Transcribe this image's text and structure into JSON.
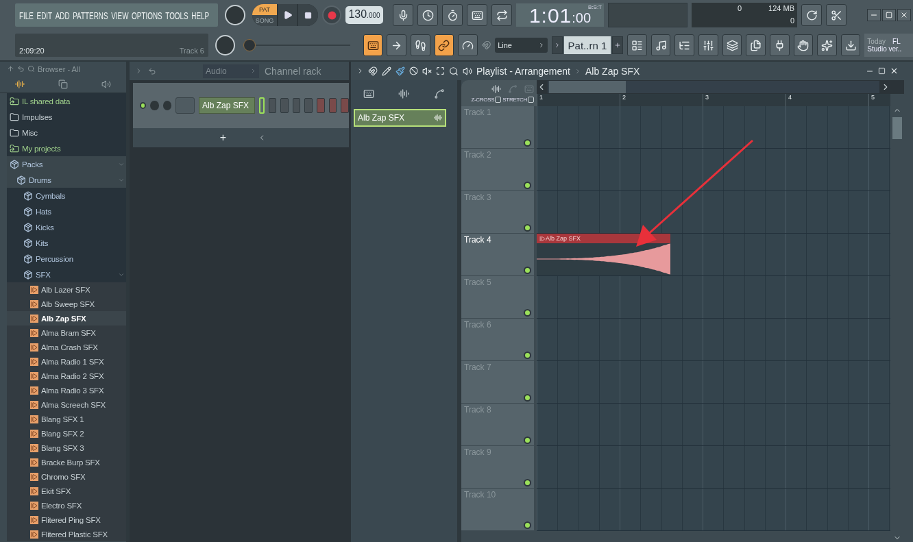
{
  "menu": [
    "FILE",
    "EDIT",
    "ADD",
    "PATTERNS",
    "VIEW",
    "OPTIONS",
    "TOOLS",
    "HELP"
  ],
  "hint": {
    "time": "2:09:20",
    "track": "Track 6"
  },
  "modes": [
    {
      "label": "PAT",
      "selected": true
    },
    {
      "label": "SONG",
      "selected": false
    }
  ],
  "tempo": {
    "whole": "130",
    "fraction": ".000"
  },
  "clock": {
    "main": "1:01",
    "sub": ":00",
    "format": "B:S:T"
  },
  "memory": {
    "cpu": "0",
    "ram": "124 MB",
    "polyphony": "0"
  },
  "master_pitch": {
    "level": 0
  },
  "snap": "Line",
  "pattern": "Pat..rn 1",
  "news": {
    "line1": "Today",
    "tag": "FL",
    "line2": "Studio ver.."
  },
  "browser": {
    "title": "Browser - All",
    "items": [
      {
        "label": "IL shared data",
        "kind": "linked"
      },
      {
        "label": "Impulses",
        "kind": "folder"
      },
      {
        "label": "Misc",
        "kind": "folder"
      },
      {
        "label": "My projects",
        "kind": "linked"
      },
      {
        "label": "Packs",
        "kind": "pack",
        "expanded": true,
        "children": [
          {
            "label": "Drums",
            "kind": "pack",
            "expanded": true,
            "children": [
              {
                "label": "Cymbals",
                "kind": "pack",
                "expanded": false
              },
              {
                "label": "Hats",
                "kind": "pack",
                "expanded": false
              },
              {
                "label": "Kicks",
                "kind": "pack",
                "expanded": false
              },
              {
                "label": "Kits",
                "kind": "pack",
                "expanded": false
              },
              {
                "label": "Percussion",
                "kind": "pack",
                "expanded": false
              },
              {
                "label": "SFX",
                "kind": "pack",
                "expanded": true,
                "children": [
                  {
                    "label": "Alb Lazer SFX",
                    "kind": "sample",
                    "selected": false
                  },
                  {
                    "label": "Alb Sweep SFX",
                    "kind": "sample",
                    "selected": false
                  },
                  {
                    "label": "Alb Zap SFX",
                    "kind": "sample",
                    "selected": true
                  },
                  {
                    "label": "Alma Bram SFX",
                    "kind": "sample",
                    "selected": false
                  },
                  {
                    "label": "Alma Crash SFX",
                    "kind": "sample",
                    "selected": false
                  },
                  {
                    "label": "Alma Radio 1 SFX",
                    "kind": "sample",
                    "selected": false
                  },
                  {
                    "label": "Alma Radio 2 SFX",
                    "kind": "sample",
                    "selected": false
                  },
                  {
                    "label": "Alma Radio 3 SFX",
                    "kind": "sample",
                    "selected": false
                  },
                  {
                    "label": "Alma Screech SFX",
                    "kind": "sample",
                    "selected": false
                  },
                  {
                    "label": "Blang SFX 1",
                    "kind": "sample",
                    "selected": false
                  },
                  {
                    "label": "Blang SFX 2",
                    "kind": "sample",
                    "selected": false
                  },
                  {
                    "label": "Blang SFX 3",
                    "kind": "sample",
                    "selected": false
                  },
                  {
                    "label": "Bracke Burp SFX",
                    "kind": "sample",
                    "selected": false
                  },
                  {
                    "label": "Chromo SFX",
                    "kind": "sample",
                    "selected": false
                  },
                  {
                    "label": "Ekit SFX",
                    "kind": "sample",
                    "selected": false
                  },
                  {
                    "label": "Electro SFX",
                    "kind": "sample",
                    "selected": false
                  },
                  {
                    "label": "Flitered Ping SFX",
                    "kind": "sample",
                    "selected": false
                  },
                  {
                    "label": "Flitered Plastic SFX",
                    "kind": "sample",
                    "selected": false
                  }
                ]
              }
            ]
          }
        ]
      }
    ]
  },
  "channel_rack": {
    "title": "Channel rack",
    "group": "Audio",
    "add": "+",
    "channels": [
      {
        "name": "Alb Zap SFX",
        "on": true
      }
    ]
  },
  "playlist": {
    "title": "Playlist - Arrangement",
    "pattern": "Alb Zap SFX",
    "picker": [
      "Alb Zap SFX"
    ],
    "zcross": {
      "label": "Z-CROSS",
      "checked": false
    },
    "stretch": {
      "label": "STRETCH",
      "checked": false
    },
    "bars": [
      "1",
      "2",
      "3",
      "4",
      "5"
    ],
    "tracks": [
      {
        "name": "Track 1",
        "selected": false
      },
      {
        "name": "Track 2",
        "selected": false
      },
      {
        "name": "Track 3",
        "selected": false
      },
      {
        "name": "Track 4",
        "selected": true,
        "clip": {
          "label": "Alb Zap SFX"
        }
      },
      {
        "name": "Track 5",
        "selected": false
      },
      {
        "name": "Track 6",
        "selected": false
      },
      {
        "name": "Track 7",
        "selected": false
      },
      {
        "name": "Track 8",
        "selected": false
      },
      {
        "name": "Track 9",
        "selected": false
      },
      {
        "name": "Track 10",
        "selected": false
      }
    ]
  }
}
